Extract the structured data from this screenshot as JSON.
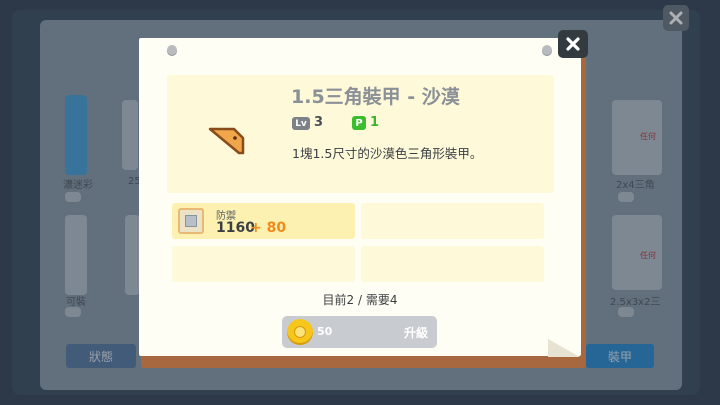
{
  "background": {
    "tile_label_left": "濃迷彩",
    "tile_label_small_1": "25",
    "tile_label_right_1": "2x4三角",
    "tile_label_right_2": "2.5x3x2三",
    "tile_label_bottom_left": "可裝",
    "badge_top_right": "任何",
    "badge_mid_right": "任何",
    "left_button_label": "狀態",
    "right_button_label": "裝甲"
  },
  "dialog": {
    "item_name": "1.5三角裝甲 - 沙漠",
    "level_tag": "Lv",
    "level_value": "3",
    "points_tag": "P",
    "points_value": "1",
    "description": "1塊1.5尺寸的沙漠色三角形裝甲。",
    "stat": {
      "label": "防禦",
      "base_value": "1160",
      "bonus": "+ 80"
    },
    "progress_text": "目前2 / 需要4",
    "upgrade": {
      "cost": "50",
      "label": "升級"
    }
  },
  "colors": {
    "item_color": "#f0a64a",
    "item_outline": "#8a4b1a",
    "bonus_color": "#f28a1c",
    "points_color": "#3bbd2d",
    "paper_bg": "#fffef4",
    "info_bg": "#fdf9d9"
  },
  "icons": {
    "close": "close-icon",
    "coin": "coin-icon",
    "stat": "armor-plate-icon",
    "item": "triangle-armor-icon"
  }
}
